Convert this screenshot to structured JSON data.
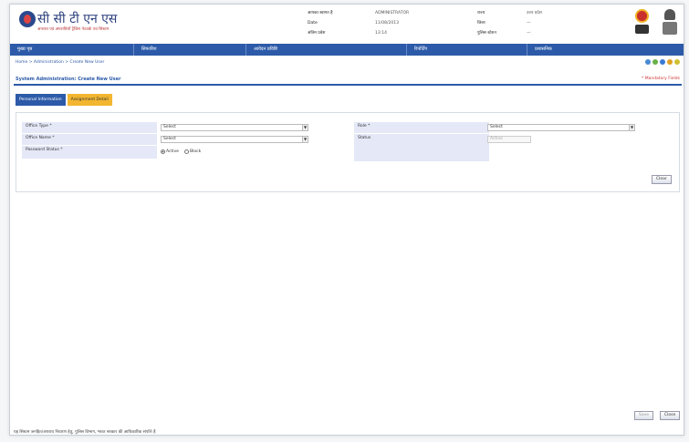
{
  "header": {
    "brand": "सी सी टी एन एस",
    "tagline": "अपराध एवं अपराधियों ट्रैकिंग नेटवर्क एवं सिस्टम",
    "info_left": [
      {
        "key": "आपका स्वागत है",
        "value": "ADMINISTRATOR"
      },
      {
        "key": "Date",
        "value": "11/08/2013"
      },
      {
        "key": "अंतिम प्रवेश",
        "value": "13:14"
      }
    ],
    "info_right": [
      {
        "key": "राज्य",
        "value": "उत्तर प्रदेश"
      },
      {
        "key": "जिला",
        "value": "—"
      },
      {
        "key": "पुलिस स्टेशन",
        "value": "—"
      }
    ]
  },
  "menu": [
    "मुख्य पृष्ठ",
    "सिफारिश",
    "आवेदन प्रविष्टि",
    "रिपोर्टिंग",
    "प्रशासनिक"
  ],
  "breadcrumb": "Home > Administration > Create New User",
  "page_title": "System Administration: Create New User",
  "mandatory_note": "* Mandatory Fields",
  "tabs": [
    "Personal Information",
    "Assignment Detail"
  ],
  "form": {
    "office_type_label": "Office Type *",
    "office_type_value": "Select",
    "office_name_label": "Office Name *",
    "office_name_value": "Select",
    "password_status_label": "Password Status *",
    "password_options": [
      "Active",
      "Block"
    ],
    "role_label": "Role *",
    "role_value": "Select",
    "status_label": "Status",
    "status_value": "Active"
  },
  "buttons": {
    "clear": "Clear",
    "save": "Save",
    "close": "Close"
  },
  "footer": "यह सिस्टम जनहित/अपराध निवारण हेतु, पुलिस विभाग, भारत सरकार की आधिकारिक संपत्ति है",
  "colors": {
    "accent": "#2c5aa8",
    "tab_inactive": "#f2b630",
    "label_bg": "#e4e8f7"
  }
}
